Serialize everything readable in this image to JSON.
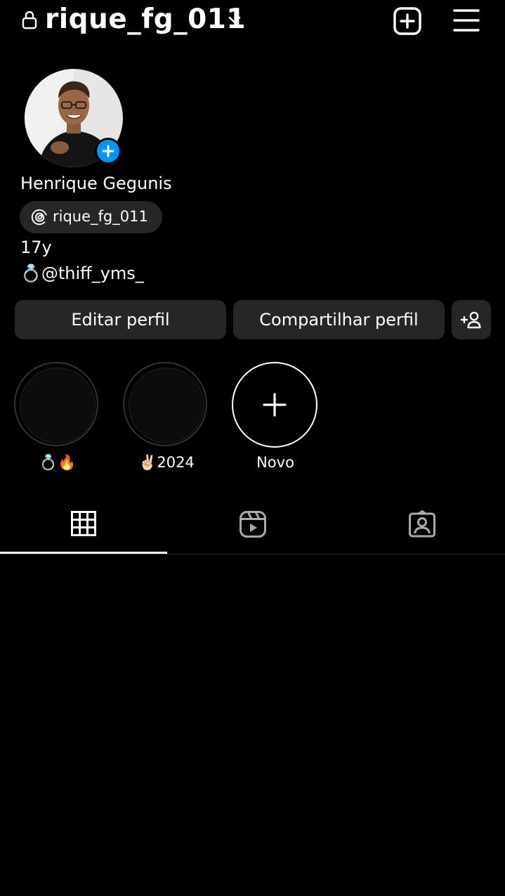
{
  "header": {
    "username": "rique_fg_011",
    "icons": [
      "lock-icon",
      "chevron-down-icon",
      "add-post-icon",
      "menu-icon"
    ]
  },
  "profile": {
    "display_name": "Henrique Gegunis",
    "threads_handle": "rique_fg_011",
    "bio_line1": "17y",
    "bio_line2": "💍@thiff_yms_"
  },
  "actions": {
    "edit_profile": "Editar perfil",
    "share_profile": "Compartilhar perfil"
  },
  "highlights": [
    {
      "label": "💍🔥"
    },
    {
      "label": "✌🏻2024"
    },
    {
      "label": "Novo"
    }
  ],
  "tabs": [
    "posts-grid-icon",
    "reels-icon",
    "tagged-icon"
  ],
  "colors": {
    "background": "#000000",
    "button": "#262626",
    "accent": "#0095f6",
    "text": "#ffffff"
  }
}
